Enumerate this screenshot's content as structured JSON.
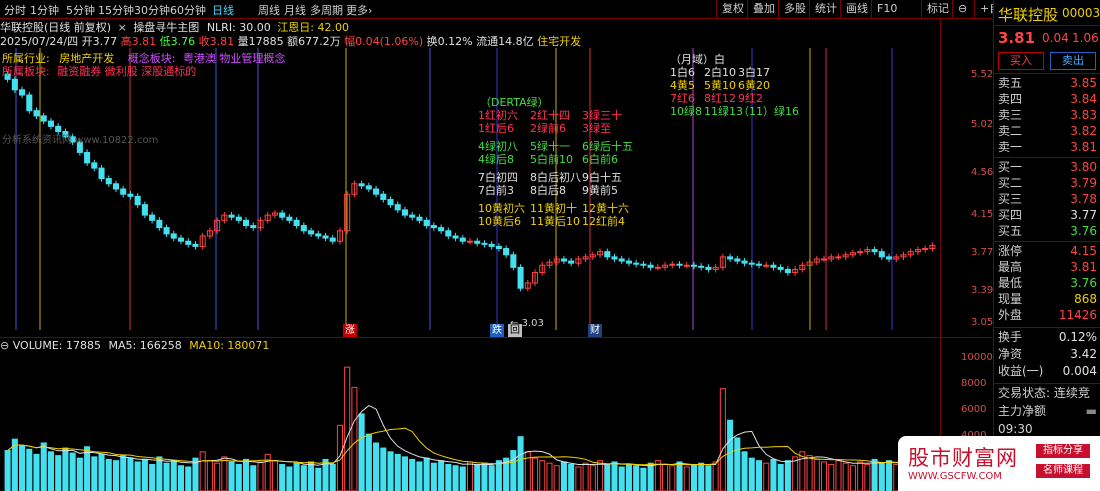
{
  "toolbar": {
    "tabs": [
      "分时",
      "1分钟",
      "5分钟",
      "15分钟",
      "30分钟",
      "60分钟",
      "日线",
      "周线",
      "月线",
      "多周期",
      "更多›"
    ],
    "active": "日线",
    "right_tools": [
      "复权",
      "叠加",
      "多股",
      "统计",
      "画线",
      "F10",
      "标记",
      "⊖",
      "+自选"
    ]
  },
  "header": {
    "title": "华联控股(日线 前复权)",
    "indicator_name": "操盘寻牛主图",
    "nlri": "NLRI: 30.00",
    "jiang_en": "江恩日: 42.00",
    "date": "2025/07/24/四",
    "open": "开3.77",
    "high": "高3.81",
    "low": "低3.76",
    "close": "收3.81",
    "volume": "量17885",
    "amount": "额677.2万",
    "change": "幅0.04(1.06%)",
    "turnover": "换0.12%",
    "float": "流通14.8亿",
    "industry_short": "住宅开发"
  },
  "annotations": {
    "industry_label": "所属行业:",
    "industry_value": "房地产开发",
    "concept_label": "概念板块:",
    "concept_value": "粤港澳 物业管理概念",
    "region_label": "所属板块:",
    "region_value": "融资融券 微利股 深股通标的",
    "watermark_small": "分析系统资讯网 www.10822.com",
    "derta_title": "（DERTA绿）",
    "derta_rows": [
      [
        "1红初六",
        "2红十四",
        "3绿三十"
      ],
      [
        "1红后6",
        "2绿前6",
        "3绿至"
      ],
      [
        "4绿初八",
        "5绿十一",
        "6绿后十五"
      ],
      [
        "4绿后8",
        "5白前10",
        "6白前6"
      ],
      [
        "7白初四",
        "8白后初八",
        "9白十五"
      ],
      [
        "7白前3",
        "8白后8",
        "9黄前5"
      ],
      [
        "10黄初六",
        "11黄初十",
        "12黄十六"
      ],
      [
        "10黄后6",
        "11黄后10",
        "12红前4"
      ]
    ],
    "month_title": "（月域）白",
    "month_rows": [
      [
        "1白6",
        "2白10",
        "3白17"
      ],
      [
        "4黄5",
        "5黄10",
        "6黄20"
      ],
      [
        "7红6",
        "8红12",
        "9红2"
      ],
      [
        "10绿8",
        "11绿13",
        "（11）绿16"
      ]
    ],
    "low_price_mark": "3.03",
    "badge_zhang": "涨",
    "badge_die": "跌",
    "badge_hui": "回",
    "badge_cai": "财"
  },
  "price_axis": [
    "5.52",
    "5.02",
    "4.56",
    "4.15",
    "3.77",
    "3.39",
    "3.05"
  ],
  "volume": {
    "label": "VOLUME: 17885",
    "ma5": "MA5: 166258",
    "ma10": "MA10: 180071",
    "axis": [
      "10000",
      "8000",
      "6000",
      "4000"
    ]
  },
  "quote_panel": {
    "name": "华联控股",
    "code": "000036",
    "price": "3.81",
    "change": "0.04",
    "pct": "1.06",
    "buy_btn": "买入",
    "sell_btn": "卖出",
    "asks": [
      [
        "卖五",
        "3.85"
      ],
      [
        "卖四",
        "3.84"
      ],
      [
        "卖三",
        "3.83"
      ],
      [
        "卖二",
        "3.82"
      ],
      [
        "卖一",
        "3.81"
      ]
    ],
    "bids": [
      [
        "买一",
        "3.80"
      ],
      [
        "买二",
        "3.79"
      ],
      [
        "买三",
        "3.78"
      ],
      [
        "买四",
        "3.77"
      ],
      [
        "买五",
        "3.76"
      ]
    ],
    "stats": [
      [
        "涨停",
        "4.15"
      ],
      [
        "最高",
        "3.81"
      ],
      [
        "最低",
        "3.76"
      ],
      [
        "现量",
        "868"
      ],
      [
        "外盘",
        "11426"
      ]
    ],
    "stats2": [
      [
        "换手",
        "0.12%"
      ],
      [
        "净资",
        "3.42"
      ],
      [
        "收益(一)",
        "0.004"
      ]
    ],
    "trade_state": "交易状态: 连续竞",
    "main_net": "主力净额",
    "time": "09:30"
  },
  "watermark": {
    "title": "股市财富网",
    "url": "WWW.GSCFW.COM",
    "tag1": "指标分享",
    "tag2": "名师课程"
  },
  "chart_data": {
    "type": "candlestick",
    "ylim": [
      3.0,
      5.7
    ],
    "closes": [
      5.4,
      5.3,
      5.25,
      5.1,
      5.05,
      5.0,
      4.95,
      4.9,
      4.85,
      4.8,
      4.7,
      4.6,
      4.55,
      4.45,
      4.4,
      4.35,
      4.3,
      4.28,
      4.2,
      4.1,
      4.05,
      3.98,
      3.92,
      3.88,
      3.85,
      3.82,
      3.8,
      3.9,
      3.95,
      4.05,
      4.1,
      4.08,
      4.05,
      4.0,
      3.98,
      4.05,
      4.1,
      4.12,
      4.08,
      4.05,
      4.0,
      3.95,
      3.92,
      3.9,
      3.88,
      3.85,
      3.95,
      4.3,
      4.4,
      4.38,
      4.35,
      4.3,
      4.25,
      4.2,
      4.15,
      4.1,
      4.08,
      4.05,
      4.0,
      3.98,
      3.95,
      3.9,
      3.88,
      3.85,
      3.85,
      3.83,
      3.82,
      3.8,
      3.78,
      3.72,
      3.6,
      3.4,
      3.45,
      3.55,
      3.62,
      3.65,
      3.68,
      3.66,
      3.64,
      3.68,
      3.7,
      3.72,
      3.75,
      3.7,
      3.68,
      3.66,
      3.64,
      3.63,
      3.62,
      3.6,
      3.6,
      3.62,
      3.63,
      3.62,
      3.62,
      3.61,
      3.6,
      3.58,
      3.6,
      3.7,
      3.68,
      3.66,
      3.64,
      3.63,
      3.62,
      3.62,
      3.6,
      3.58,
      3.55,
      3.58,
      3.62,
      3.65,
      3.68,
      3.68,
      3.7,
      3.7,
      3.72,
      3.74,
      3.75,
      3.77,
      3.75,
      3.7,
      3.68,
      3.7,
      3.72,
      3.75,
      3.77,
      3.78,
      3.81
    ],
    "volumes": [
      3200,
      4100,
      3600,
      3300,
      2900,
      3800,
      3100,
      2800,
      3400,
      3000,
      2600,
      3500,
      2700,
      2900,
      2500,
      2400,
      2800,
      2600,
      2300,
      2500,
      2100,
      2700,
      2200,
      2400,
      2000,
      1900,
      2600,
      3100,
      2400,
      2200,
      2700,
      2300,
      2100,
      2500,
      2000,
      2300,
      2900,
      2400,
      2100,
      1900,
      2200,
      2000,
      2300,
      1800,
      2500,
      2100,
      5200,
      9800,
      8200,
      6100,
      4500,
      3800,
      3400,
      3100,
      2900,
      2700,
      2500,
      2300,
      2600,
      2200,
      2400,
      2100,
      2000,
      1900,
      2300,
      2100,
      2200,
      2000,
      2400,
      2600,
      3200,
      4300,
      3100,
      2600,
      2400,
      2200,
      2000,
      2300,
      2100,
      1900,
      2200,
      2000,
      2400,
      2100,
      2300,
      1900,
      2100,
      2000,
      1800,
      2200,
      2400,
      2100,
      2000,
      2300,
      1900,
      2100,
      2200,
      2000,
      2300,
      8100,
      5600,
      4200,
      3100,
      2600,
      2400,
      2200,
      2500,
      2100,
      2400,
      2700,
      3100,
      2800,
      2500,
      2300,
      2100,
      2400,
      2200,
      2000,
      2300,
      2100,
      2500,
      2200,
      2400,
      2100,
      2300,
      2000,
      2200,
      2100,
      1800
    ]
  }
}
